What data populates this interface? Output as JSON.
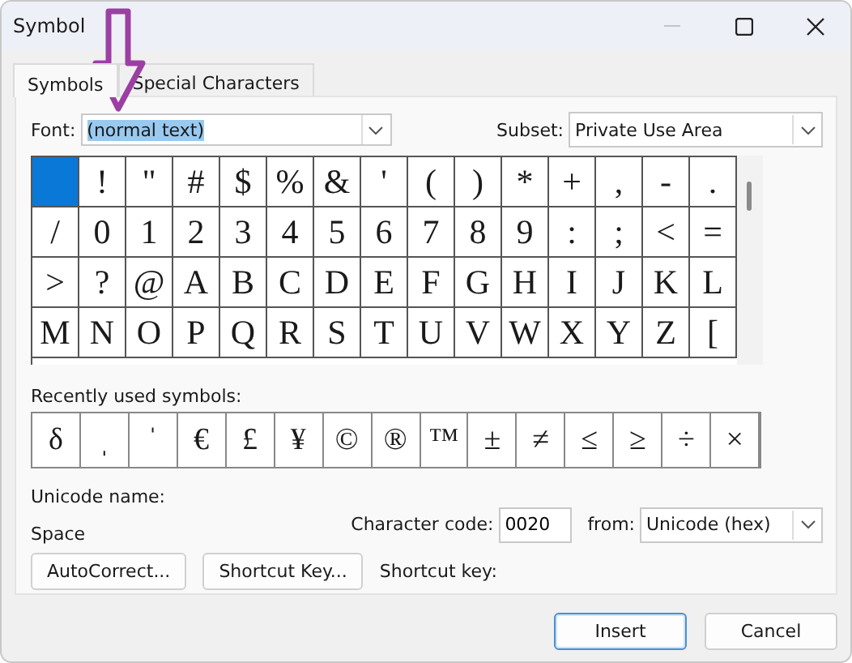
{
  "window": {
    "title": "Symbol"
  },
  "tabs": [
    {
      "label": "Symbols",
      "selected": true
    },
    {
      "label": "Special Characters",
      "selected": false
    }
  ],
  "font": {
    "label": "Font:",
    "value": "(normal text)"
  },
  "subset": {
    "label": "Subset:",
    "value": "Private Use Area"
  },
  "grid": [
    {
      "selected": true
    },
    {
      "char": "!",
      "selected": false
    },
    {
      "char": "\"",
      "selected": false
    },
    {
      "char": "#",
      "selected": false
    },
    {
      "char": "$",
      "selected": false
    },
    {
      "char": "%",
      "selected": false
    },
    {
      "char": "&",
      "selected": false
    },
    {
      "char": "'",
      "selected": false
    },
    {
      "char": "(",
      "selected": false
    },
    {
      "char": ")",
      "selected": false
    },
    {
      "char": "*",
      "selected": false
    },
    {
      "char": "+",
      "selected": false
    },
    {
      "char": ",",
      "selected": false
    },
    {
      "char": "-",
      "selected": false
    },
    {
      "char": ".",
      "selected": false
    },
    {
      "char": "/",
      "selected": false
    },
    {
      "char": "0",
      "selected": false
    },
    {
      "char": "1",
      "selected": false
    },
    {
      "char": "2",
      "selected": false
    },
    {
      "char": "3",
      "selected": false
    },
    {
      "char": "4",
      "selected": false
    },
    {
      "char": "5",
      "selected": false
    },
    {
      "char": "6",
      "selected": false
    },
    {
      "char": "7",
      "selected": false
    },
    {
      "char": "8",
      "selected": false
    },
    {
      "char": "9",
      "selected": false
    },
    {
      "char": ":",
      "selected": false
    },
    {
      "char": ";",
      "selected": false
    },
    {
      "char": "<",
      "selected": false
    },
    {
      "char": "=",
      "selected": false
    },
    {
      "char": ">",
      "selected": false
    },
    {
      "char": "?",
      "selected": false
    },
    {
      "char": "@",
      "selected": false
    },
    {
      "char": "A",
      "selected": false
    },
    {
      "char": "B",
      "selected": false
    },
    {
      "char": "C",
      "selected": false
    },
    {
      "char": "D",
      "selected": false
    },
    {
      "char": "E",
      "selected": false
    },
    {
      "char": "F",
      "selected": false
    },
    {
      "char": "G",
      "selected": false
    },
    {
      "char": "H",
      "selected": false
    },
    {
      "char": "I",
      "selected": false
    },
    {
      "char": "J",
      "selected": false
    },
    {
      "char": "K",
      "selected": false
    },
    {
      "char": "L",
      "selected": false
    },
    {
      "char": "M",
      "selected": false
    },
    {
      "char": "N",
      "selected": false
    },
    {
      "char": "O",
      "selected": false
    },
    {
      "char": "P",
      "selected": false
    },
    {
      "char": "Q",
      "selected": false
    },
    {
      "char": "R",
      "selected": false
    },
    {
      "char": "S",
      "selected": false
    },
    {
      "char": "T",
      "selected": false
    },
    {
      "char": "U",
      "selected": false
    },
    {
      "char": "V",
      "selected": false
    },
    {
      "char": "W",
      "selected": false
    },
    {
      "char": "X",
      "selected": false
    },
    {
      "char": "Y",
      "selected": false
    },
    {
      "char": "Z",
      "selected": false
    },
    {
      "char": "[",
      "selected": false
    }
  ],
  "recent": {
    "label": "Recently used symbols:",
    "symbols": [
      "δ",
      "ˌ",
      "ˈ",
      "€",
      "£",
      "¥",
      "©",
      "®",
      "™",
      "±",
      "≠",
      "≤",
      "≥",
      "÷",
      "×"
    ]
  },
  "unicode_name": {
    "label": "Unicode name:",
    "value": "Space"
  },
  "character_code": {
    "label": "Character code:",
    "value": "0020"
  },
  "from": {
    "label": "from:",
    "value": "Unicode (hex)"
  },
  "buttons": [
    {
      "label": "AutoCorrect..."
    },
    {
      "label": "Shortcut Key..."
    }
  ],
  "shortcut_key": {
    "label": "Shortcut key:"
  },
  "footer_buttons": [
    {
      "label": "Insert",
      "default": true
    },
    {
      "label": "Cancel",
      "default": false
    }
  ]
}
